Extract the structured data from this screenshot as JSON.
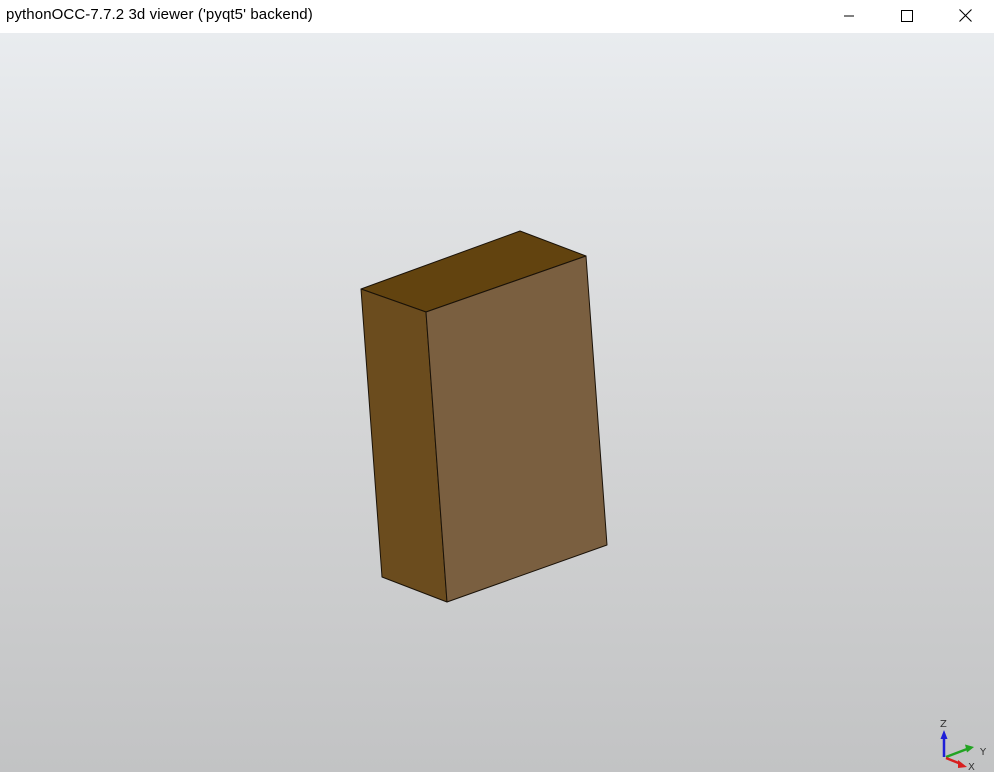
{
  "window": {
    "title": "pythonOCC-7.7.2 3d viewer ('pyqt5' backend)",
    "controls": {
      "minimize_icon": "minimize-icon",
      "maximize_icon": "maximize-icon",
      "close_icon": "close-icon"
    }
  },
  "viewer": {
    "background_top": "#e9ecef",
    "background_bottom": "#c2c3c4",
    "shape": {
      "type": "box",
      "colors": {
        "top_face": "#62430f",
        "left_face": "#6b4c1e",
        "front_face": "#7a5f40",
        "edge": "#1a1208"
      }
    },
    "triedron": {
      "x_label": "X",
      "y_label": "Y",
      "z_label": "Z",
      "x_color": "#d81f1f",
      "y_color": "#22a322",
      "z_color": "#1f1fd8"
    }
  }
}
